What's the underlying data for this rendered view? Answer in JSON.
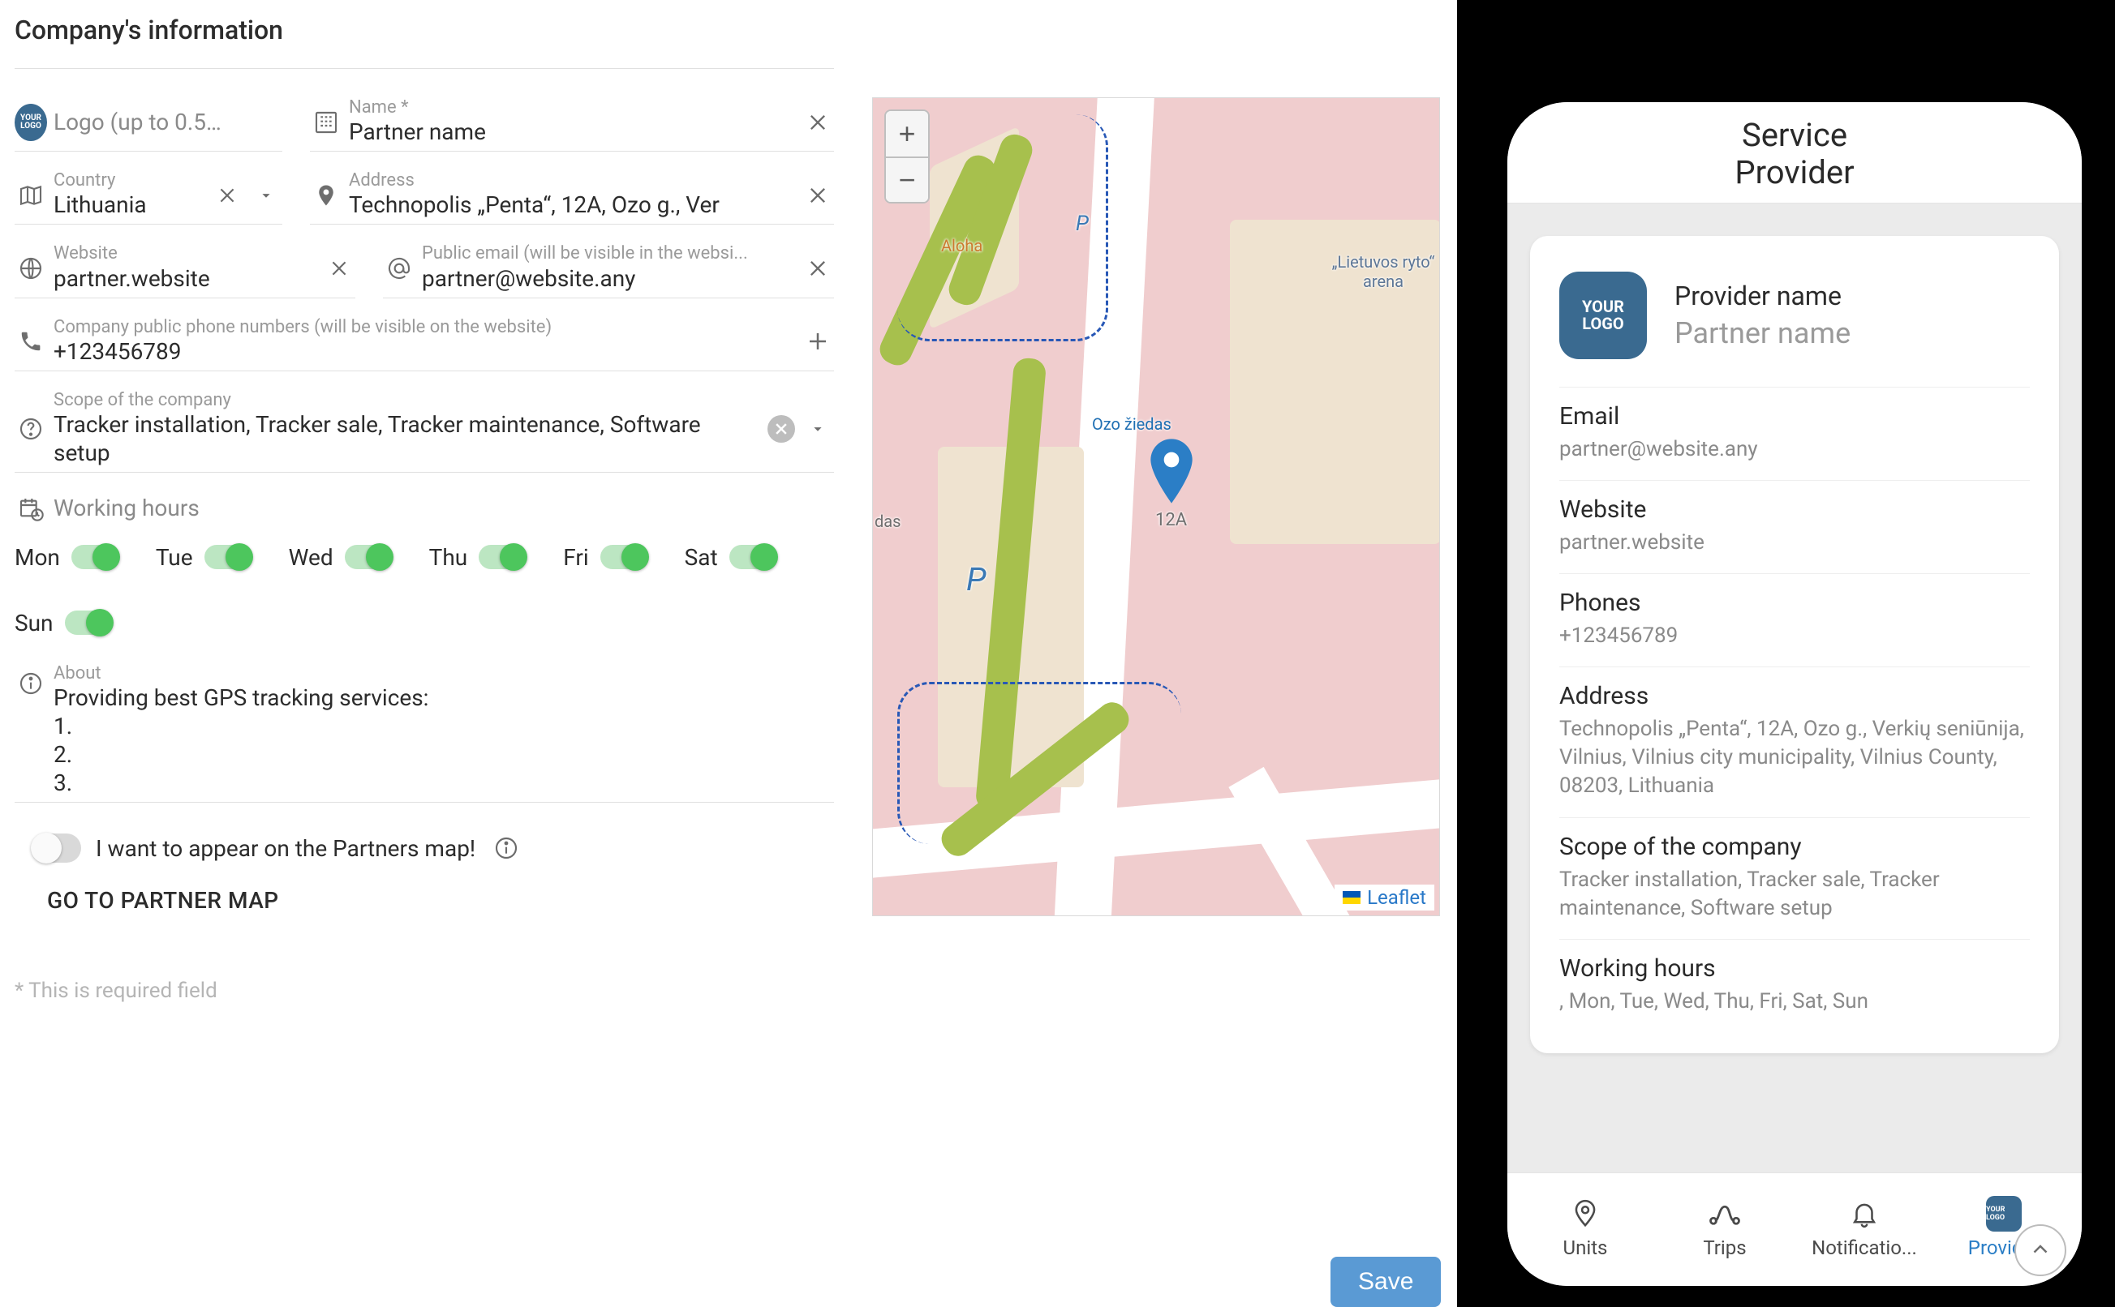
{
  "section_title": "Company's information",
  "logo_text": "YOUR LOGO",
  "fields": {
    "logo": {
      "label": "Logo (up to 0.5…"
    },
    "name": {
      "label": "Name *",
      "value": "Partner name"
    },
    "country": {
      "label": "Country",
      "value": "Lithuania"
    },
    "address": {
      "label": "Address",
      "value": "Technopolis „Penta“, 12A, Ozo g., Ver"
    },
    "website": {
      "label": "Website",
      "value": "partner.website"
    },
    "email": {
      "label": "Public email (will be visible in the websi...",
      "value": "partner@website.any"
    },
    "phone": {
      "label": "Company public phone numbers (will be visible on the website)",
      "value": "+123456789"
    },
    "scope": {
      "label": "Scope of the company",
      "value": "Tracker installation, Tracker sale, Tracker maintenance, Software setup"
    },
    "hours_label": "Working hours",
    "about": {
      "label": "About",
      "value": "Providing best GPS tracking services:\n1.\n2.\n3."
    }
  },
  "days": [
    {
      "short": "Mon",
      "on": true
    },
    {
      "short": "Tue",
      "on": true
    },
    {
      "short": "Wed",
      "on": true
    },
    {
      "short": "Thu",
      "on": true
    },
    {
      "short": "Fri",
      "on": true
    },
    {
      "short": "Sat",
      "on": true
    },
    {
      "short": "Sun",
      "on": true
    }
  ],
  "partners_map": {
    "toggle_label": "I want to appear on the Partners map!",
    "on": false,
    "go_label": "GO TO PARTNER MAP"
  },
  "required_note": "* This is required field",
  "save_label": "Save",
  "map": {
    "attribution": "Leaflet",
    "marker_label": "12A",
    "labels": {
      "arena": "„Lietuvos ryto“ arena",
      "ozo": "Ozo žiedas",
      "aloha": "Aloha",
      "das": "das",
      "parking": "P"
    }
  },
  "phone": {
    "header1": "Service",
    "header2": "Provider",
    "provider_name_label": "Provider name",
    "provider_name_value": "Partner name",
    "rows": {
      "email": {
        "k": "Email",
        "v": "partner@website.any"
      },
      "website": {
        "k": "Website",
        "v": "partner.website"
      },
      "phones": {
        "k": "Phones",
        "v": "+123456789"
      },
      "address": {
        "k": "Address",
        "v": "Technopolis „Penta“, 12A, Ozo g., Verkių seniūnija, Vilnius, Vilnius city municipality, Vilnius County, 08203, Lithuania"
      },
      "scope": {
        "k": "Scope of the company",
        "v": "Tracker installation, Tracker sale, Tracker maintenance, Software setup"
      },
      "hours": {
        "k": "Working hours",
        "v": ", Mon, Tue, Wed, Thu, Fri, Sat, Sun"
      }
    },
    "tabs": {
      "units": "Units",
      "trips": "Trips",
      "notifications": "Notificatio...",
      "provider": "Provider"
    }
  }
}
